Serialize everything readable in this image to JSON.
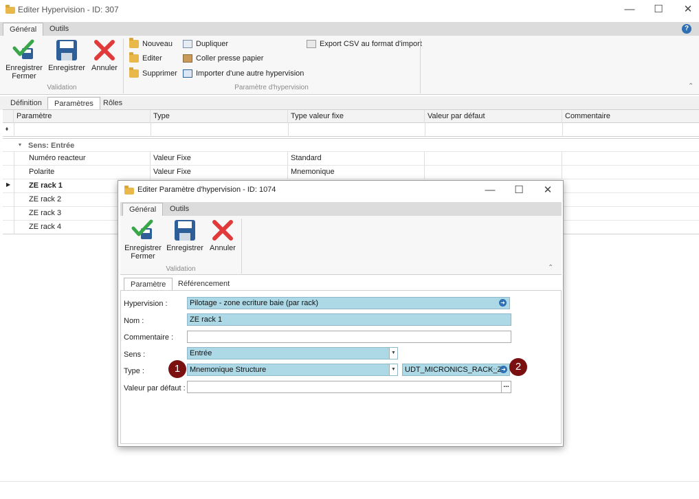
{
  "main_window": {
    "title": "Editer Hypervision - ID: 307",
    "controls": {
      "minimize": "—",
      "maximize": "☐",
      "close": "✕"
    },
    "ribbon_tabs": [
      {
        "label": "Général"
      },
      {
        "label": "Outils"
      }
    ],
    "help": "?",
    "validation": {
      "save_close": "Enregistrer\nFermer",
      "save": "Enregistrer",
      "cancel": "Annuler",
      "group_label": "Validation"
    },
    "param_group": {
      "new": "Nouveau",
      "edit": "Editer",
      "delete": "Supprimer",
      "duplicate": "Dupliquer",
      "paste": "Coller presse papier",
      "import": "Importer d'une autre hypervision",
      "export": "Export CSV au format d'import",
      "group_label": "Paramètre d'hypervision"
    },
    "page_tabs": [
      {
        "label": "Définition"
      },
      {
        "label": "Paramètres"
      },
      {
        "label": "Rôles"
      }
    ],
    "grid": {
      "columns": [
        "Paramètre",
        "Type",
        "Type valeur fixe",
        "Valeur par défaut",
        "Commentaire"
      ],
      "group_label": "Sens: Entrée",
      "rows": [
        {
          "name": "Numéro reacteur",
          "type": "Valeur Fixe",
          "fixed": "Standard"
        },
        {
          "name": "Polarite",
          "type": "Valeur Fixe",
          "fixed": "Mnemonique"
        },
        {
          "name": "ZE rack 1",
          "type": "",
          "fixed": ""
        },
        {
          "name": "ZE rack 2",
          "type": "",
          "fixed": ""
        },
        {
          "name": "ZE rack 3",
          "type": "",
          "fixed": ""
        },
        {
          "name": "ZE rack 4",
          "type": "",
          "fixed": ""
        }
      ]
    }
  },
  "dialog": {
    "title": "Editer Paramètre d'hypervision - ID: 1074",
    "ribbon_tabs": [
      {
        "label": "Général"
      },
      {
        "label": "Outils"
      }
    ],
    "validation": {
      "save_close": "Enregistrer\nFermer",
      "save": "Enregistrer",
      "cancel": "Annuler",
      "group_label": "Validation"
    },
    "tabs": [
      {
        "label": "Paramètre"
      },
      {
        "label": "Référencement"
      }
    ],
    "form": {
      "hypervision_label": "Hypervision :",
      "hypervision_value": "Pilotage - zone ecriture baie (par rack)",
      "nom_label": "Nom :",
      "nom_value": "ZE rack 1",
      "commentaire_label": "Commentaire :",
      "commentaire_value": "",
      "sens_label": "Sens :",
      "sens_value": "Entrée",
      "type_label": "Type :",
      "type_value": "Mnemonique Structure",
      "type_ref_value": "UDT_MICRONICS_RACK_Z",
      "valeur_label": "Valeur par défaut :",
      "valeur_value": "",
      "ellipsis": "..."
    },
    "badges": [
      "1",
      "2"
    ]
  },
  "colors": {
    "accent_blue": "#add8e6",
    "badge": "#7a1010",
    "check_green": "#3aa64a",
    "cancel_red": "#e03a3a",
    "save_blue": "#2f5f99"
  }
}
